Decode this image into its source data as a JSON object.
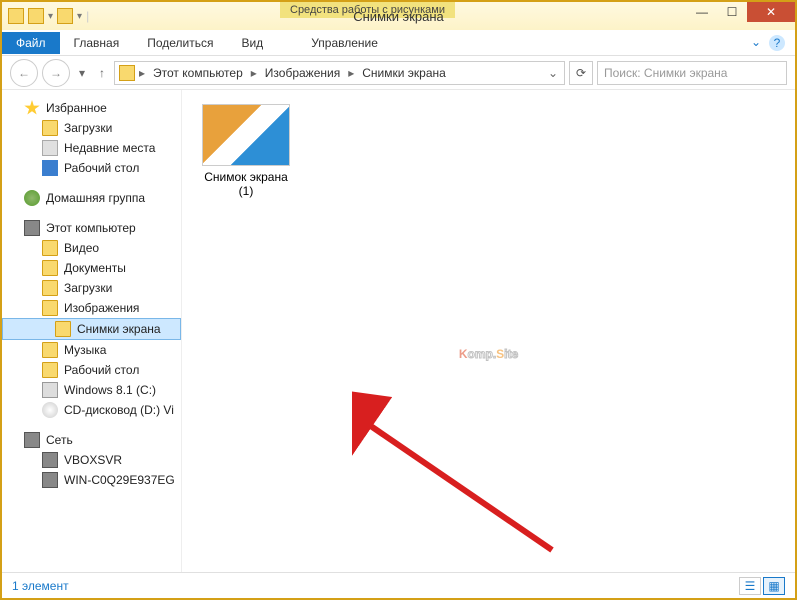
{
  "title": "Снимки экрана",
  "context_tab": "Средства работы с рисунками",
  "ribbon": {
    "file": "Файл",
    "tabs": [
      "Главная",
      "Поделиться",
      "Вид"
    ],
    "ctx_tab": "Управление"
  },
  "breadcrumbs": [
    "Этот компьютер",
    "Изображения",
    "Снимки экрана"
  ],
  "search_placeholder": "Поиск: Снимки экрана",
  "sidebar": {
    "favorites": {
      "label": "Избранное",
      "items": [
        "Загрузки",
        "Недавние места",
        "Рабочий стол"
      ]
    },
    "homegroup": "Домашняя группа",
    "this_pc": {
      "label": "Этот компьютер",
      "items": [
        "Видео",
        "Документы",
        "Загрузки",
        "Изображения"
      ],
      "screenshots": "Снимки экрана",
      "items2": [
        "Музыка",
        "Рабочий стол",
        "Windows 8.1 (C:)",
        "CD-дисковод (D:) Vi"
      ]
    },
    "network": {
      "label": "Сеть",
      "items": [
        "VBOXSVR",
        "WIN-C0Q29E937EG"
      ]
    }
  },
  "file_item": "Снимок экрана (1)",
  "status": "1 элемент",
  "watermark": {
    "p1": "K",
    "p2": "omp.",
    "p3": "S",
    "p4": "ite"
  }
}
